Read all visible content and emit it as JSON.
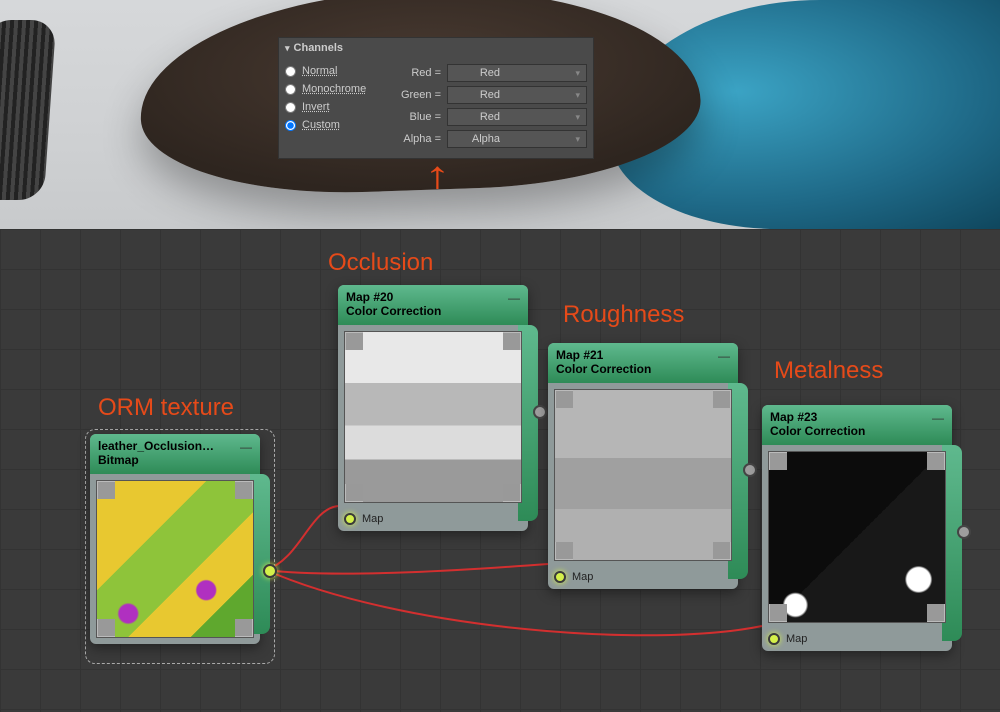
{
  "panel": {
    "title": "Channels",
    "radios": [
      "Normal",
      "Monochrome",
      "Invert",
      "Custom"
    ],
    "selected_radio": 3,
    "rows": [
      {
        "label": "Red =",
        "value": "Red"
      },
      {
        "label": "Green =",
        "value": "Red"
      },
      {
        "label": "Blue =",
        "value": "Red"
      },
      {
        "label": "Alpha =",
        "value": "Alpha"
      }
    ]
  },
  "annotations": {
    "orm": "ORM texture",
    "occlusion": "Occlusion",
    "roughness": "Roughness",
    "metalness": "Metalness"
  },
  "nodes": {
    "orm": {
      "title": "leather_Occlusion…",
      "type": "Bitmap"
    },
    "occlusion": {
      "title": "Map #20",
      "type": "Color Correction",
      "input_label": "Map"
    },
    "roughness": {
      "title": "Map #21",
      "type": "Color Correction",
      "input_label": "Map"
    },
    "metalness": {
      "title": "Map #23",
      "type": "Color Correction",
      "input_label": "Map"
    }
  }
}
